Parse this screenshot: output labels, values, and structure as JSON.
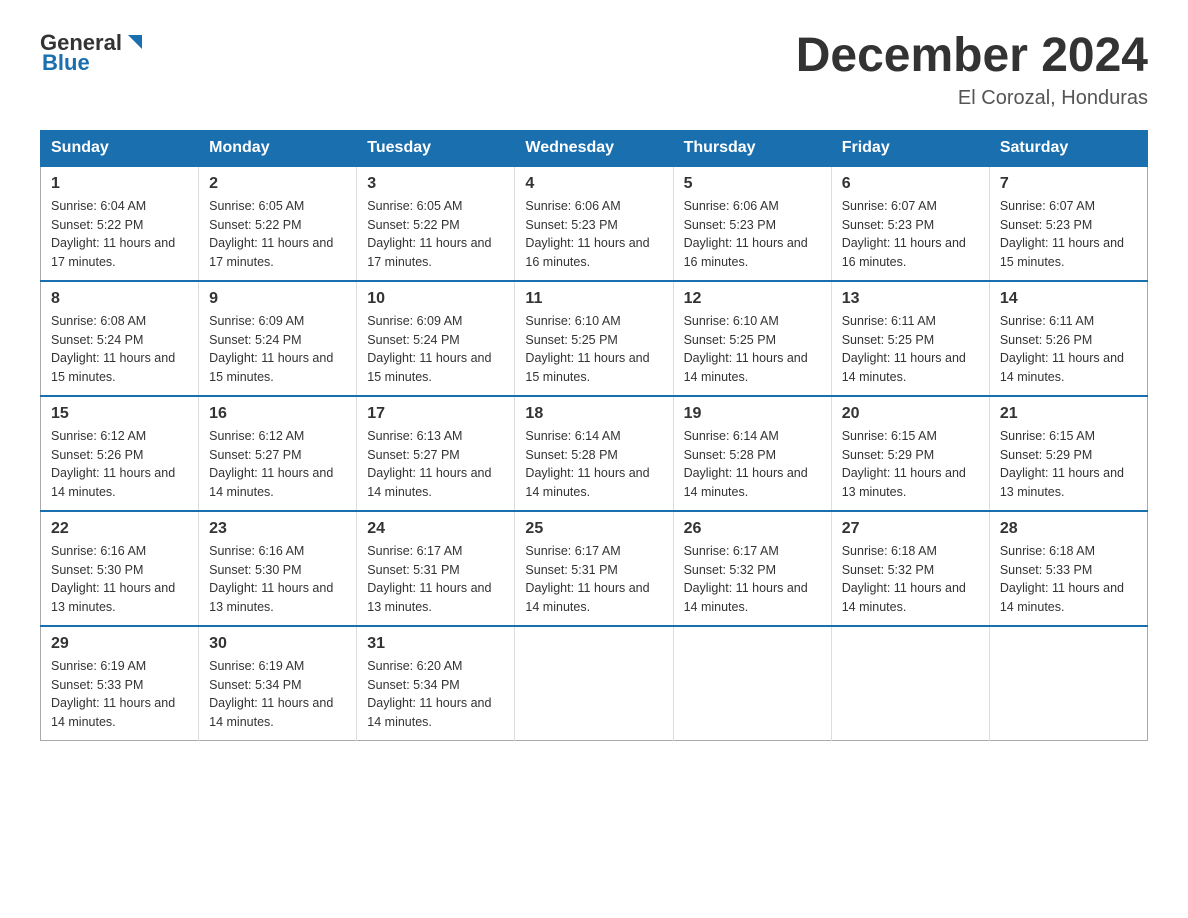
{
  "logo": {
    "text_general": "General",
    "text_blue": "Blue"
  },
  "title": "December 2024",
  "location": "El Corozal, Honduras",
  "days_of_week": [
    "Sunday",
    "Monday",
    "Tuesday",
    "Wednesday",
    "Thursday",
    "Friday",
    "Saturday"
  ],
  "weeks": [
    [
      {
        "day": "1",
        "sunrise": "6:04 AM",
        "sunset": "5:22 PM",
        "daylight": "11 hours and 17 minutes."
      },
      {
        "day": "2",
        "sunrise": "6:05 AM",
        "sunset": "5:22 PM",
        "daylight": "11 hours and 17 minutes."
      },
      {
        "day": "3",
        "sunrise": "6:05 AM",
        "sunset": "5:22 PM",
        "daylight": "11 hours and 17 minutes."
      },
      {
        "day": "4",
        "sunrise": "6:06 AM",
        "sunset": "5:23 PM",
        "daylight": "11 hours and 16 minutes."
      },
      {
        "day": "5",
        "sunrise": "6:06 AM",
        "sunset": "5:23 PM",
        "daylight": "11 hours and 16 minutes."
      },
      {
        "day": "6",
        "sunrise": "6:07 AM",
        "sunset": "5:23 PM",
        "daylight": "11 hours and 16 minutes."
      },
      {
        "day": "7",
        "sunrise": "6:07 AM",
        "sunset": "5:23 PM",
        "daylight": "11 hours and 15 minutes."
      }
    ],
    [
      {
        "day": "8",
        "sunrise": "6:08 AM",
        "sunset": "5:24 PM",
        "daylight": "11 hours and 15 minutes."
      },
      {
        "day": "9",
        "sunrise": "6:09 AM",
        "sunset": "5:24 PM",
        "daylight": "11 hours and 15 minutes."
      },
      {
        "day": "10",
        "sunrise": "6:09 AM",
        "sunset": "5:24 PM",
        "daylight": "11 hours and 15 minutes."
      },
      {
        "day": "11",
        "sunrise": "6:10 AM",
        "sunset": "5:25 PM",
        "daylight": "11 hours and 15 minutes."
      },
      {
        "day": "12",
        "sunrise": "6:10 AM",
        "sunset": "5:25 PM",
        "daylight": "11 hours and 14 minutes."
      },
      {
        "day": "13",
        "sunrise": "6:11 AM",
        "sunset": "5:25 PM",
        "daylight": "11 hours and 14 minutes."
      },
      {
        "day": "14",
        "sunrise": "6:11 AM",
        "sunset": "5:26 PM",
        "daylight": "11 hours and 14 minutes."
      }
    ],
    [
      {
        "day": "15",
        "sunrise": "6:12 AM",
        "sunset": "5:26 PM",
        "daylight": "11 hours and 14 minutes."
      },
      {
        "day": "16",
        "sunrise": "6:12 AM",
        "sunset": "5:27 PM",
        "daylight": "11 hours and 14 minutes."
      },
      {
        "day": "17",
        "sunrise": "6:13 AM",
        "sunset": "5:27 PM",
        "daylight": "11 hours and 14 minutes."
      },
      {
        "day": "18",
        "sunrise": "6:14 AM",
        "sunset": "5:28 PM",
        "daylight": "11 hours and 14 minutes."
      },
      {
        "day": "19",
        "sunrise": "6:14 AM",
        "sunset": "5:28 PM",
        "daylight": "11 hours and 14 minutes."
      },
      {
        "day": "20",
        "sunrise": "6:15 AM",
        "sunset": "5:29 PM",
        "daylight": "11 hours and 13 minutes."
      },
      {
        "day": "21",
        "sunrise": "6:15 AM",
        "sunset": "5:29 PM",
        "daylight": "11 hours and 13 minutes."
      }
    ],
    [
      {
        "day": "22",
        "sunrise": "6:16 AM",
        "sunset": "5:30 PM",
        "daylight": "11 hours and 13 minutes."
      },
      {
        "day": "23",
        "sunrise": "6:16 AM",
        "sunset": "5:30 PM",
        "daylight": "11 hours and 13 minutes."
      },
      {
        "day": "24",
        "sunrise": "6:17 AM",
        "sunset": "5:31 PM",
        "daylight": "11 hours and 13 minutes."
      },
      {
        "day": "25",
        "sunrise": "6:17 AM",
        "sunset": "5:31 PM",
        "daylight": "11 hours and 14 minutes."
      },
      {
        "day": "26",
        "sunrise": "6:17 AM",
        "sunset": "5:32 PM",
        "daylight": "11 hours and 14 minutes."
      },
      {
        "day": "27",
        "sunrise": "6:18 AM",
        "sunset": "5:32 PM",
        "daylight": "11 hours and 14 minutes."
      },
      {
        "day": "28",
        "sunrise": "6:18 AM",
        "sunset": "5:33 PM",
        "daylight": "11 hours and 14 minutes."
      }
    ],
    [
      {
        "day": "29",
        "sunrise": "6:19 AM",
        "sunset": "5:33 PM",
        "daylight": "11 hours and 14 minutes."
      },
      {
        "day": "30",
        "sunrise": "6:19 AM",
        "sunset": "5:34 PM",
        "daylight": "11 hours and 14 minutes."
      },
      {
        "day": "31",
        "sunrise": "6:20 AM",
        "sunset": "5:34 PM",
        "daylight": "11 hours and 14 minutes."
      },
      null,
      null,
      null,
      null
    ]
  ]
}
